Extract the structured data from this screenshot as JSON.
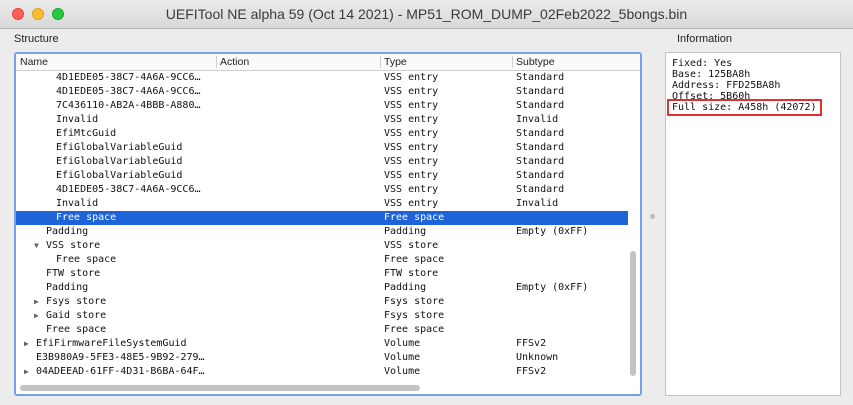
{
  "window": {
    "title": "UEFITool NE alpha 59 (Oct 14 2021) - MP51_ROM_DUMP_02Feb2022_5bongs.bin"
  },
  "structure": {
    "label": "Structure",
    "columns": [
      "Name",
      "Action",
      "Type",
      "Subtype"
    ],
    "rows": [
      {
        "name": "4D1EDE05-38C7-4A6A-9CC6…",
        "type": "VSS entry",
        "subtype": "Standard",
        "indent": 4,
        "arrow": ""
      },
      {
        "name": "4D1EDE05-38C7-4A6A-9CC6…",
        "type": "VSS entry",
        "subtype": "Standard",
        "indent": 4,
        "arrow": ""
      },
      {
        "name": "7C436110-AB2A-4BBB-A880…",
        "type": "VSS entry",
        "subtype": "Standard",
        "indent": 4,
        "arrow": ""
      },
      {
        "name": "Invalid",
        "type": "VSS entry",
        "subtype": "Invalid",
        "indent": 4,
        "arrow": ""
      },
      {
        "name": "EfiMtcGuid",
        "type": "VSS entry",
        "subtype": "Standard",
        "indent": 4,
        "arrow": ""
      },
      {
        "name": "EfiGlobalVariableGuid",
        "type": "VSS entry",
        "subtype": "Standard",
        "indent": 4,
        "arrow": ""
      },
      {
        "name": "EfiGlobalVariableGuid",
        "type": "VSS entry",
        "subtype": "Standard",
        "indent": 4,
        "arrow": ""
      },
      {
        "name": "EfiGlobalVariableGuid",
        "type": "VSS entry",
        "subtype": "Standard",
        "indent": 4,
        "arrow": ""
      },
      {
        "name": "4D1EDE05-38C7-4A6A-9CC6…",
        "type": "VSS entry",
        "subtype": "Standard",
        "indent": 4,
        "arrow": ""
      },
      {
        "name": "Invalid",
        "type": "VSS entry",
        "subtype": "Invalid",
        "indent": 4,
        "arrow": ""
      },
      {
        "name": "Free space",
        "type": "Free space",
        "subtype": "",
        "indent": 4,
        "arrow": "",
        "selected": true
      },
      {
        "name": "Padding",
        "type": "Padding",
        "subtype": "Empty (0xFF)",
        "indent": 3,
        "arrow": ""
      },
      {
        "name": "VSS store",
        "type": "VSS store",
        "subtype": "",
        "indent": 3,
        "arrow": "▼"
      },
      {
        "name": "Free space",
        "type": "Free space",
        "subtype": "",
        "indent": 4,
        "arrow": ""
      },
      {
        "name": "FTW store",
        "type": "FTW store",
        "subtype": "",
        "indent": 3,
        "arrow": ""
      },
      {
        "name": "Padding",
        "type": "Padding",
        "subtype": "Empty (0xFF)",
        "indent": 3,
        "arrow": ""
      },
      {
        "name": "Fsys store",
        "type": "Fsys store",
        "subtype": "",
        "indent": 3,
        "arrow": "▶"
      },
      {
        "name": "Gaid store",
        "type": "Fsys store",
        "subtype": "",
        "indent": 3,
        "arrow": "▶"
      },
      {
        "name": "Free space",
        "type": "Free space",
        "subtype": "",
        "indent": 3,
        "arrow": ""
      },
      {
        "name": "EfiFirmwareFileSystemGuid",
        "type": "Volume",
        "subtype": "FFSv2",
        "indent": 2,
        "arrow": "▶"
      },
      {
        "name": "E3B980A9-5FE3-48E5-9B92-279…",
        "type": "Volume",
        "subtype": "Unknown",
        "indent": 2,
        "arrow": ""
      },
      {
        "name": "04ADEEAD-61FF-4D31-B6BA-64F…",
        "type": "Volume",
        "subtype": "FFSv2",
        "indent": 2,
        "arrow": "▶"
      }
    ]
  },
  "information": {
    "label": "Information",
    "lines": [
      {
        "text": "Fixed: Yes"
      },
      {
        "text": "Base: 125BA8h"
      },
      {
        "text": "Address: FFD25BA8h"
      },
      {
        "text": "Offset: 5B60h"
      },
      {
        "text": "Full size: A458h (42072)",
        "highlight": true
      }
    ]
  },
  "colors": {
    "selection": "#1f63d8",
    "highlight_box": "#e03030",
    "focus_border": "#7aa1e6"
  }
}
